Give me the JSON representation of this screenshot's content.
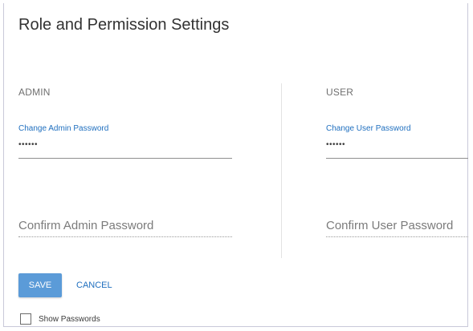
{
  "page": {
    "title": "Role and Permission Settings"
  },
  "admin": {
    "section_title": "ADMIN",
    "change_password_label": "Change Admin Password",
    "password_value": "••••••",
    "confirm_placeholder": "Confirm Admin Password"
  },
  "user": {
    "section_title": "USER",
    "change_password_label": "Change User Password",
    "password_value": "••••••",
    "confirm_placeholder": "Confirm User Password"
  },
  "actions": {
    "save_label": "SAVE",
    "cancel_label": "CANCEL"
  },
  "options": {
    "show_passwords_label": "Show Passwords",
    "show_passwords_checked": false
  },
  "colors": {
    "accent": "#1f6fbf",
    "save_button_bg": "#5b9bd8"
  }
}
